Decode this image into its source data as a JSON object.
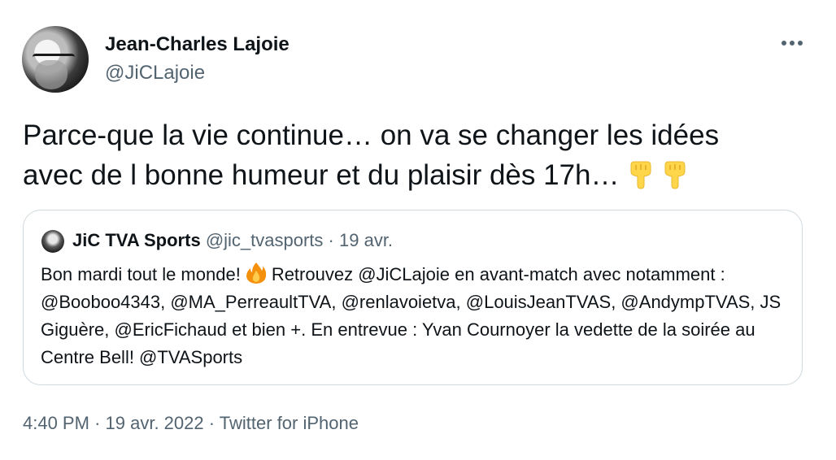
{
  "author": {
    "name": "Jean-Charles Lajoie",
    "handle": "@JiCLajoie",
    "avatar_icon": "avatar-photo"
  },
  "more_icon": "more-horizontal-icon",
  "tweet": {
    "text": "Parce-que la vie continue… on va se changer les idées\navec de l bonne humeur et du plaisir dès 17h…",
    "emojis": [
      "backhand-index-pointing-down",
      "backhand-index-pointing-down"
    ]
  },
  "quote": {
    "name": "JiC TVA Sports",
    "handle": "@jic_tvasports",
    "separator": "·",
    "date": "19 avr.",
    "text_before_emoji": "Bon mardi tout le monde!",
    "emoji": "fire",
    "text_after_emoji": "Retrouvez @JiCLajoie en avant-match avec notamment : @Booboo4343, @MA_PerreaultTVA, @renlavoietva, @LouisJeanTVAS, @AndympTVAS, JS Giguère, @EricFichaud et bien +. En entrevue : Yvan Cournoyer la vedette de la soirée au Centre Bell! @TVASports"
  },
  "meta": {
    "time": "4:40 PM",
    "separator1": "·",
    "date": "19 avr. 2022",
    "separator2": "·",
    "source": "Twitter for iPhone"
  },
  "colors": {
    "text_primary": "#0f1419",
    "text_secondary": "#536471",
    "border": "#cfd9de",
    "emoji_yellow": "#ffd54a",
    "fire_orange": "#f4900c"
  }
}
